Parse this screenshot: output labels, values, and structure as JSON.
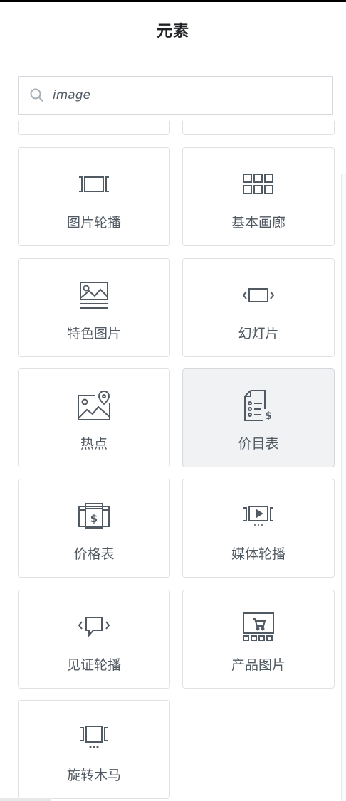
{
  "header": {
    "title": "元素"
  },
  "search": {
    "value": "image"
  },
  "widgets": [
    {
      "label": "图片轮播",
      "icon": "image-carousel-icon",
      "active": false
    },
    {
      "label": "基本画廊",
      "icon": "basic-gallery-icon",
      "active": false
    },
    {
      "label": "特色图片",
      "icon": "featured-image-icon",
      "active": false
    },
    {
      "label": "幻灯片",
      "icon": "slides-icon",
      "active": false
    },
    {
      "label": "热点",
      "icon": "hotspot-icon",
      "active": false
    },
    {
      "label": "价目表",
      "icon": "price-list-icon",
      "active": true
    },
    {
      "label": "价格表",
      "icon": "price-table-icon",
      "active": false
    },
    {
      "label": "媒体轮播",
      "icon": "media-carousel-icon",
      "active": false
    },
    {
      "label": "见证轮播",
      "icon": "testimonial-carousel-icon",
      "active": false
    },
    {
      "label": "产品图片",
      "icon": "product-images-icon",
      "active": false
    },
    {
      "label": "旋转木马",
      "icon": "carousel-icon",
      "active": false
    }
  ]
}
